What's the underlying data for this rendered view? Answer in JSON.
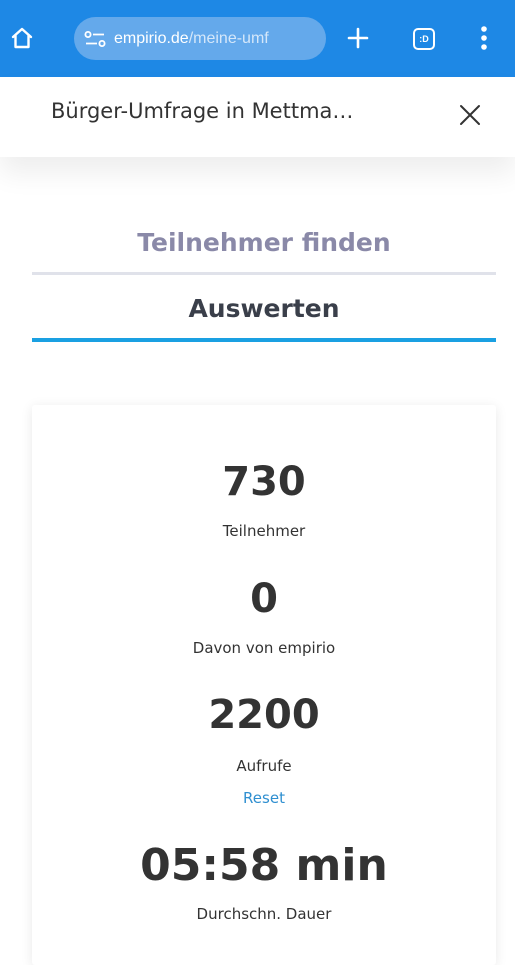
{
  "browser": {
    "url_domain": "empirio.de",
    "url_path": "/meine-umf",
    "tab_count_label": ":D"
  },
  "header": {
    "title": "Bürger-Umfrage in Mettma…"
  },
  "tabs": [
    {
      "label": "Teilnehmer finden",
      "active": false
    },
    {
      "label": "Auswerten",
      "active": true
    }
  ],
  "stats": {
    "participants": {
      "value": "730",
      "label": "Teilnehmer"
    },
    "from_empirio": {
      "value": "0",
      "label": "Davon von empirio"
    },
    "views": {
      "value": "2200",
      "label": "Aufrufe",
      "reset_label": "Reset"
    },
    "duration": {
      "value": "05:58 min",
      "label": "Durchschn. Dauer"
    }
  },
  "colors": {
    "browser_bar": "#1e88e5",
    "active_tab_underline": "#1aa0e2",
    "inactive_tab_text": "#8a89a8",
    "link": "#2f8fd0"
  },
  "icons": [
    "home-icon",
    "site-info-icon",
    "plus-icon",
    "tab-switcher-icon",
    "more-vert-icon",
    "close-icon"
  ]
}
